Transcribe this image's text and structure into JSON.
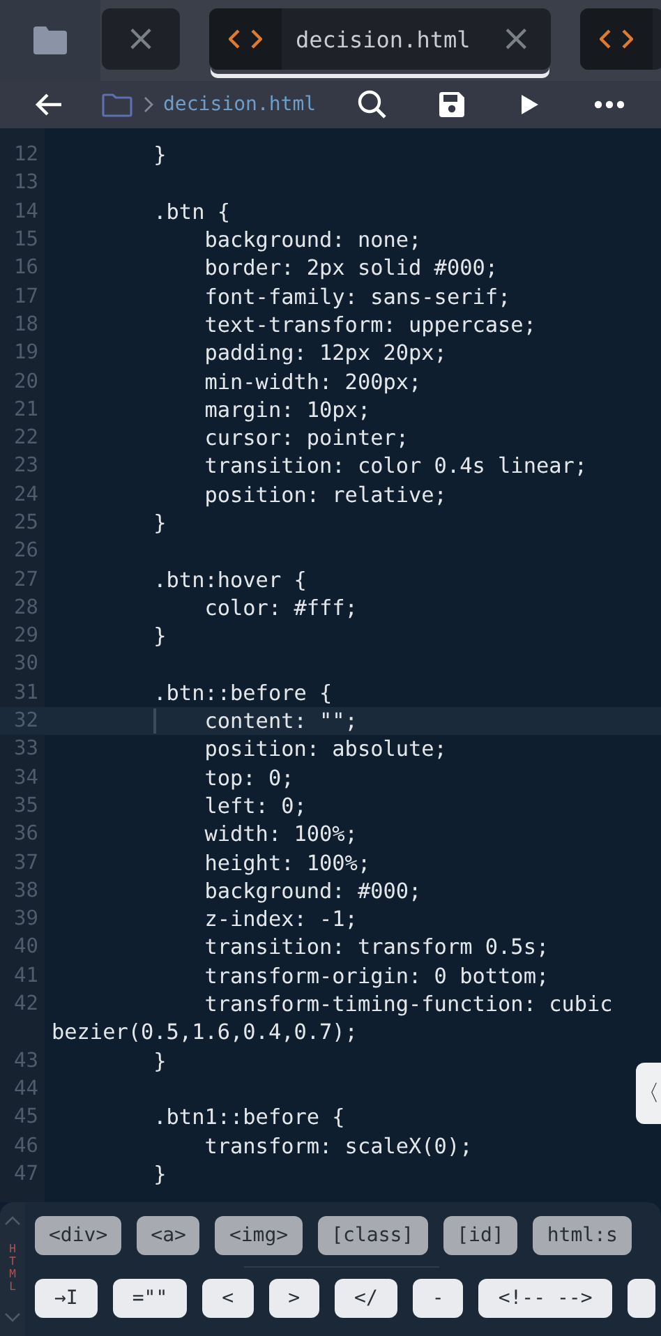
{
  "tabs": [
    {
      "kind": "partial-left",
      "close": "×",
      "selected": false
    },
    {
      "kind": "file",
      "label": "decision.html",
      "close": "×",
      "selected": true
    },
    {
      "kind": "partial-right",
      "selected": false
    }
  ],
  "breadcrumb": {
    "file": "decision.html"
  },
  "code_lines": [
    {
      "number": "12",
      "text": "        }",
      "current": false
    },
    {
      "number": "13",
      "current": false
    },
    {
      "number": "14",
      "text": "        .btn {",
      "current": false
    },
    {
      "number": "15",
      "text": "            background: none;",
      "current": false
    },
    {
      "number": "16",
      "text": "            border: 2px solid #000;",
      "current": false
    },
    {
      "number": "17",
      "text": "            font-family: sans-serif;",
      "current": false
    },
    {
      "number": "18",
      "text": "            text-transform: uppercase;",
      "current": false
    },
    {
      "number": "19",
      "text": "            padding: 12px 20px;",
      "current": false
    },
    {
      "number": "20",
      "text": "            min-width: 200px;",
      "current": false
    },
    {
      "number": "21",
      "text": "            margin: 10px;",
      "current": false
    },
    {
      "number": "22",
      "text": "            cursor: pointer;",
      "current": false
    },
    {
      "number": "23",
      "text": "            transition: color 0.4s linear;",
      "current": false
    },
    {
      "number": "24",
      "text": "            position: relative;",
      "current": false
    },
    {
      "number": "25",
      "text": "        }",
      "current": false
    },
    {
      "number": "26",
      "current": false
    },
    {
      "number": "27",
      "text": "        .btn:hover {",
      "current": false
    },
    {
      "number": "28",
      "text": "            color: #fff;",
      "current": false
    },
    {
      "number": "29",
      "text": "        }",
      "current": false
    },
    {
      "number": "30",
      "current": false
    },
    {
      "number": "31",
      "text": "        .btn::before {",
      "current": false
    },
    {
      "number": "32",
      "text": "            content: \"\";",
      "current": true
    },
    {
      "number": "33",
      "text": "            position: absolute;",
      "current": false
    },
    {
      "number": "34",
      "text": "            top: 0;",
      "current": false
    },
    {
      "number": "35",
      "text": "            left: 0;",
      "current": false
    },
    {
      "number": "36",
      "text": "            width: 100%;",
      "current": false
    },
    {
      "number": "37",
      "text": "            height: 100%;",
      "current": false
    },
    {
      "number": "38",
      "text": "            background: #000;",
      "current": false
    },
    {
      "number": "39",
      "text": "            z-index: -1;",
      "current": false
    },
    {
      "number": "40",
      "text": "            transition: transform 0.5s;",
      "current": false
    },
    {
      "number": "41",
      "text": "            transform-origin: 0 bottom;",
      "current": false
    },
    {
      "number": "42",
      "text": "            transform-timing-function: cubic",
      "wrap": "bezier(0.5,1.6,0.4,0.7);",
      "current": false
    },
    {
      "number": "43",
      "text": "        }",
      "current": false
    },
    {
      "number": "44",
      "current": false
    },
    {
      "number": "45",
      "text": "        .btn1::before {",
      "current": false
    },
    {
      "number": "46",
      "text": "            transform: scaleX(0);",
      "current": false
    },
    {
      "number": "47",
      "text": "        }",
      "current": false
    }
  ],
  "side_handle": {
    "glyph": "〈"
  },
  "keys_panel": {
    "mode": "HTML",
    "row_1": [
      "<div>",
      "<a>",
      "<img>",
      "[class]",
      "[id]",
      "html:s"
    ],
    "row_2": [
      "→I",
      "=\"\"",
      "<",
      ">",
      "</",
      "-",
      "<!-- -->"
    ]
  }
}
